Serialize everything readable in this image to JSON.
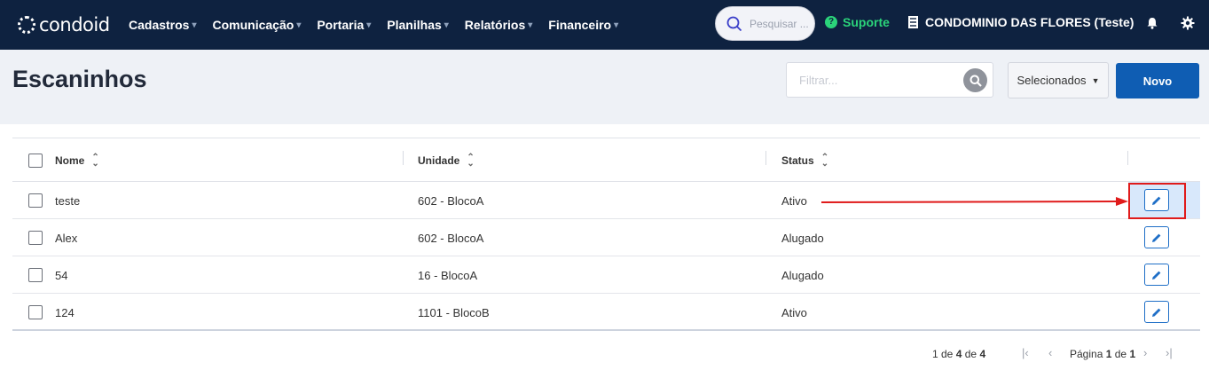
{
  "brand": {
    "name": "condoid",
    "logo_icon": "condoid-logo-icon"
  },
  "nav": [
    {
      "label": "Cadastros"
    },
    {
      "label": "Comunicação"
    },
    {
      "label": "Portaria"
    },
    {
      "label": "Planilhas"
    },
    {
      "label": "Relatórios"
    },
    {
      "label": "Financeiro"
    }
  ],
  "header_tools": {
    "search_placeholder": "Pesquisar ...",
    "support_label": "Suporte",
    "condo_label": "CONDOMINIO DAS FLORES (Teste)"
  },
  "page": {
    "title": "Escaninhos",
    "filter_placeholder": "Filtrar...",
    "selected_label": "Selecionados",
    "new_label": "Novo"
  },
  "table": {
    "columns": [
      "Nome",
      "Unidade",
      "Status"
    ],
    "rows": [
      {
        "nome": "teste",
        "unidade": "602 - BlocoA",
        "status": "Ativo"
      },
      {
        "nome": "Alex",
        "unidade": "602 - BlocoA",
        "status": "Alugado"
      },
      {
        "nome": "54",
        "unidade": "16 - BlocoA",
        "status": "Alugado"
      },
      {
        "nome": "124",
        "unidade": "1101 - BlocoB",
        "status": "Ativo"
      }
    ]
  },
  "pagination": {
    "range_prefix": "1 de",
    "range_count": "4",
    "range_mid": "de",
    "range_total": "4",
    "page_prefix": "Página",
    "page_current": "1",
    "page_mid": "de",
    "page_total": "1"
  },
  "colors": {
    "nav_bg": "#0e2240",
    "accent": "#0f5db3",
    "support": "#2bd47a",
    "annotation": "#e01b1b"
  }
}
